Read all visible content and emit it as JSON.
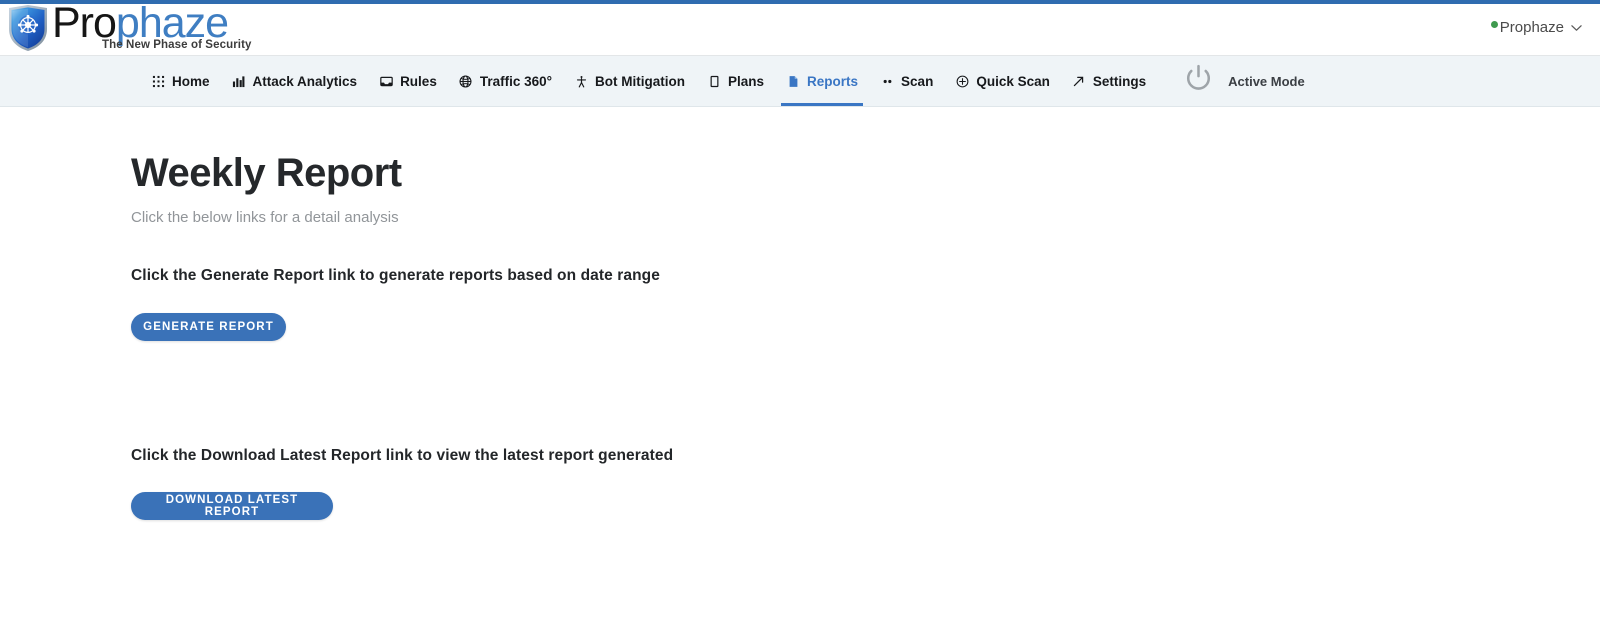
{
  "brand": {
    "name_part1": "Pro",
    "name_part2": "phaze",
    "tagline": "The New Phase of Security",
    "shield_icon": "shield-logo-icon",
    "accent_color": "#3f7ec2"
  },
  "header": {
    "account_name": "Prophaze",
    "status_dot_icon": "online-status-dot",
    "status_color": "#3f9a4e",
    "caret_icon": "chevron-down-icon"
  },
  "nav": {
    "items": [
      {
        "label": "Home",
        "icon": "grid-icon",
        "active": false
      },
      {
        "label": "Attack Analytics",
        "icon": "bar-chart-icon",
        "active": false
      },
      {
        "label": "Rules",
        "icon": "inbox-icon",
        "active": false
      },
      {
        "label": "Traffic 360°",
        "icon": "globe-icon",
        "active": false
      },
      {
        "label": "Bot Mitigation",
        "icon": "person-icon",
        "active": false
      },
      {
        "label": "Plans",
        "icon": "square-icon",
        "active": false
      },
      {
        "label": "Reports",
        "icon": "document-icon",
        "active": true
      },
      {
        "label": "Scan",
        "icon": "two-dots-icon",
        "active": false
      },
      {
        "label": "Quick Scan",
        "icon": "plus-circle-icon",
        "active": false
      },
      {
        "label": "Settings",
        "icon": "arrow-up-right-icon",
        "active": false
      }
    ],
    "active_color": "#3a76c4",
    "mode": {
      "label": "Active Mode",
      "icon": "power-icon"
    }
  },
  "main": {
    "title": "Weekly Report",
    "subtitle": "Click the below links for a detail analysis",
    "sections": [
      {
        "heading": "Click the Generate Report link to generate reports based on date range",
        "button_label": "GENERATE  REPORT"
      },
      {
        "heading": "Click the Download Latest Report link to view the latest report generated",
        "button_label": "DOWNLOAD LATEST REPORT"
      }
    ],
    "button_color": "#3a72b8"
  }
}
